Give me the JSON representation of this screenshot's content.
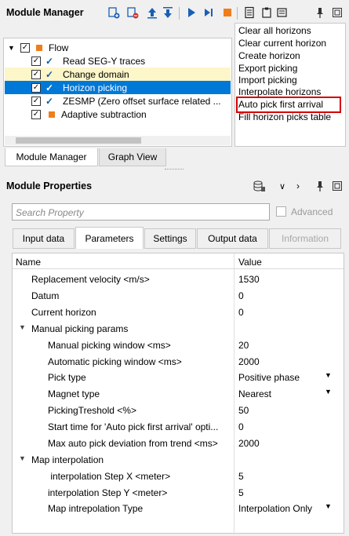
{
  "module_manager": {
    "title": "Module Manager",
    "tree": [
      {
        "label": "Flow",
        "checked": true,
        "icon": "orange-square"
      },
      {
        "label": "Read SEG-Y traces",
        "checked": true
      },
      {
        "label": "Change domain",
        "checked": true
      },
      {
        "label": "Horizon picking",
        "checked": true
      },
      {
        "label": "ZESMP (Zero offset surface related ...",
        "checked": true
      },
      {
        "label": "Adaptive subtraction",
        "checked": true,
        "icon": "orange-square"
      }
    ],
    "menu": [
      "Clear all horizons",
      "Clear current horizon",
      "Create horizon",
      "Export picking",
      "Import picking",
      "Interpolate horizons",
      "Auto pick first arrival",
      "Fill horizon picks table"
    ],
    "view_tabs": [
      "Module Manager",
      "Graph View"
    ]
  },
  "module_properties": {
    "title": "Module Properties",
    "search_placeholder": "Search Property",
    "advanced_label": "Advanced",
    "tabs": [
      "Input data",
      "Parameters",
      "Settings",
      "Output data",
      "Information"
    ],
    "columns": {
      "name": "Name",
      "value": "Value"
    },
    "rows": [
      {
        "label": "Replacement velocity <m/s>",
        "value": "1530"
      },
      {
        "label": "Datum",
        "value": "0"
      },
      {
        "label": "Current horizon",
        "value": "0"
      },
      {
        "label": "Manual picking params",
        "value": ""
      },
      {
        "label": "Manual picking window <ms>",
        "value": "20"
      },
      {
        "label": "Automatic picking window <ms>",
        "value": "2000"
      },
      {
        "label": "Pick type",
        "value": "Positive phase"
      },
      {
        "label": "Magnet type",
        "value": "Nearest"
      },
      {
        "label": "PickingTreshold <%>",
        "value": "50"
      },
      {
        "label": "Start time for 'Auto pick first arrival' opti...",
        "value": "0"
      },
      {
        "label": "Max auto pick deviation from trend <ms>",
        "value": "2000"
      },
      {
        "label": "Map interpolation",
        "value": ""
      },
      {
        "label": " interpolation Step X <meter>",
        "value": "5"
      },
      {
        "label": "interpolation Step Y <meter>",
        "value": "5"
      },
      {
        "label": "Map intrepolation Type",
        "value": "Interpolation Only"
      }
    ]
  }
}
